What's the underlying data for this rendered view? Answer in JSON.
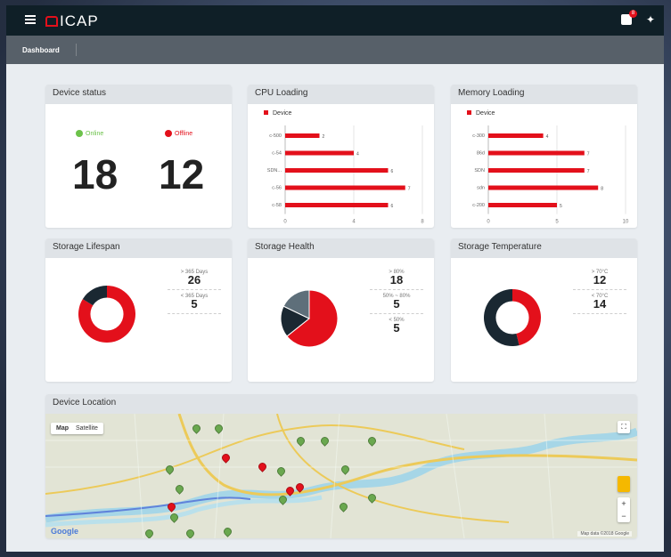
{
  "app": {
    "logo_text": "ICAP",
    "notifications": "8"
  },
  "breadcrumb": "Dashboard",
  "device_status": {
    "title": "Device status",
    "online_label": "Online",
    "offline_label": "Offline",
    "online_count": "18",
    "offline_count": "12",
    "online_color": "#6cc24a",
    "offline_color": "#e3101b"
  },
  "cpu_loading": {
    "title": "CPU Loading",
    "legend": "Device",
    "chart_data": {
      "type": "bar",
      "orientation": "horizontal",
      "categories": [
        "c-500",
        "c-54",
        "SDN...",
        "c-56",
        "c-58"
      ],
      "values": [
        2,
        4,
        6,
        7,
        6
      ],
      "xlim": [
        0,
        8
      ],
      "xticks": [
        "0",
        "4",
        "8"
      ],
      "color": "#e3101b"
    }
  },
  "memory_loading": {
    "title": "Memory Loading",
    "legend": "Device",
    "chart_data": {
      "type": "bar",
      "orientation": "horizontal",
      "categories": [
        "c-300",
        "86d",
        "SDN",
        "sdn",
        "c-200"
      ],
      "values": [
        4,
        7,
        7,
        8,
        5
      ],
      "xlim": [
        0,
        10
      ],
      "xticks": [
        "0",
        "5",
        "10"
      ],
      "color": "#e3101b"
    }
  },
  "storage_lifespan": {
    "title": "Storage Lifespan",
    "stats": [
      {
        "label": "> 365 Days",
        "value": "26"
      },
      {
        "label": "< 365 Days",
        "value": "5"
      }
    ],
    "chart_data": {
      "type": "pie",
      "labels": [
        "> 365 Days",
        "< 365 Days"
      ],
      "values": [
        26,
        5
      ],
      "colors": [
        "#e3101b",
        "#1a2832"
      ],
      "donut": true
    }
  },
  "storage_health": {
    "title": "Storage Health",
    "stats": [
      {
        "label": "> 80%",
        "value": "18"
      },
      {
        "label": "50% ~ 80%",
        "value": "5"
      },
      {
        "label": "< 50%",
        "value": "5"
      }
    ],
    "chart_data": {
      "type": "pie",
      "labels": [
        "> 80%",
        "50% ~ 80%",
        "< 50%"
      ],
      "values": [
        18,
        5,
        5
      ],
      "colors": [
        "#e3101b",
        "#1a2832",
        "#5e6f7a"
      ],
      "donut": false
    }
  },
  "storage_temperature": {
    "title": "Storage Temperature",
    "stats": [
      {
        "label": "> 70°C",
        "value": "12"
      },
      {
        "label": "< 70°C",
        "value": "14"
      }
    ],
    "chart_data": {
      "type": "pie",
      "labels": [
        "> 70°C",
        "< 70°C"
      ],
      "values": [
        12,
        14
      ],
      "colors": [
        "#e3101b",
        "#1a2832"
      ],
      "donut": true
    }
  },
  "device_location": {
    "title": "Device Location",
    "map_btn": "Map",
    "satellite_btn": "Satellite",
    "google": "Google",
    "attribution": "Map data ©2018 Google",
    "zoom_in": "+",
    "zoom_out": "−"
  }
}
